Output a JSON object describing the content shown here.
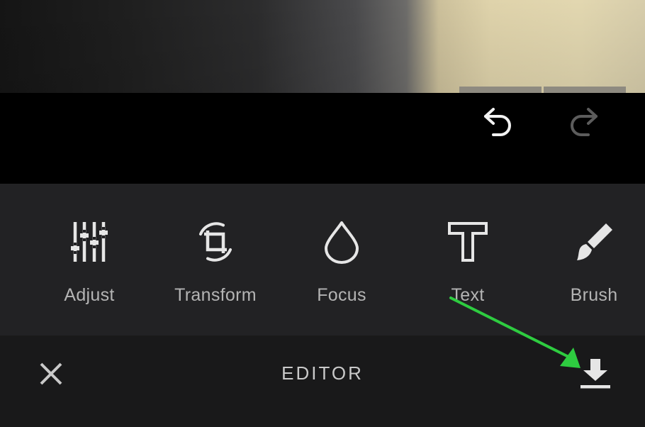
{
  "photo_preview": {
    "description": "",
    "strip_tabs": 2
  },
  "history": {
    "undo_icon": "undo-arrow-icon",
    "redo_icon": "redo-arrow-icon",
    "undo_enabled": true,
    "redo_enabled": false
  },
  "tools": [
    {
      "id": "adjust",
      "label": "Adjust",
      "icon": "sliders-icon"
    },
    {
      "id": "transform",
      "label": "Transform",
      "icon": "crop-rotate-icon"
    },
    {
      "id": "focus",
      "label": "Focus",
      "icon": "droplet-icon"
    },
    {
      "id": "text",
      "label": "Text",
      "icon": "text-t-icon"
    },
    {
      "id": "brush",
      "label": "Brush",
      "icon": "brush-icon"
    }
  ],
  "bottom_bar": {
    "title": "EDITOR",
    "close_icon": "close-icon",
    "download_icon": "download-icon"
  },
  "colors": {
    "tools_background": "#222224",
    "bottom_background": "#19191a",
    "icon_light": "#e6e6e6",
    "label_gray": "#b4b4b4",
    "annotation_arrow": "#2ecc40"
  }
}
